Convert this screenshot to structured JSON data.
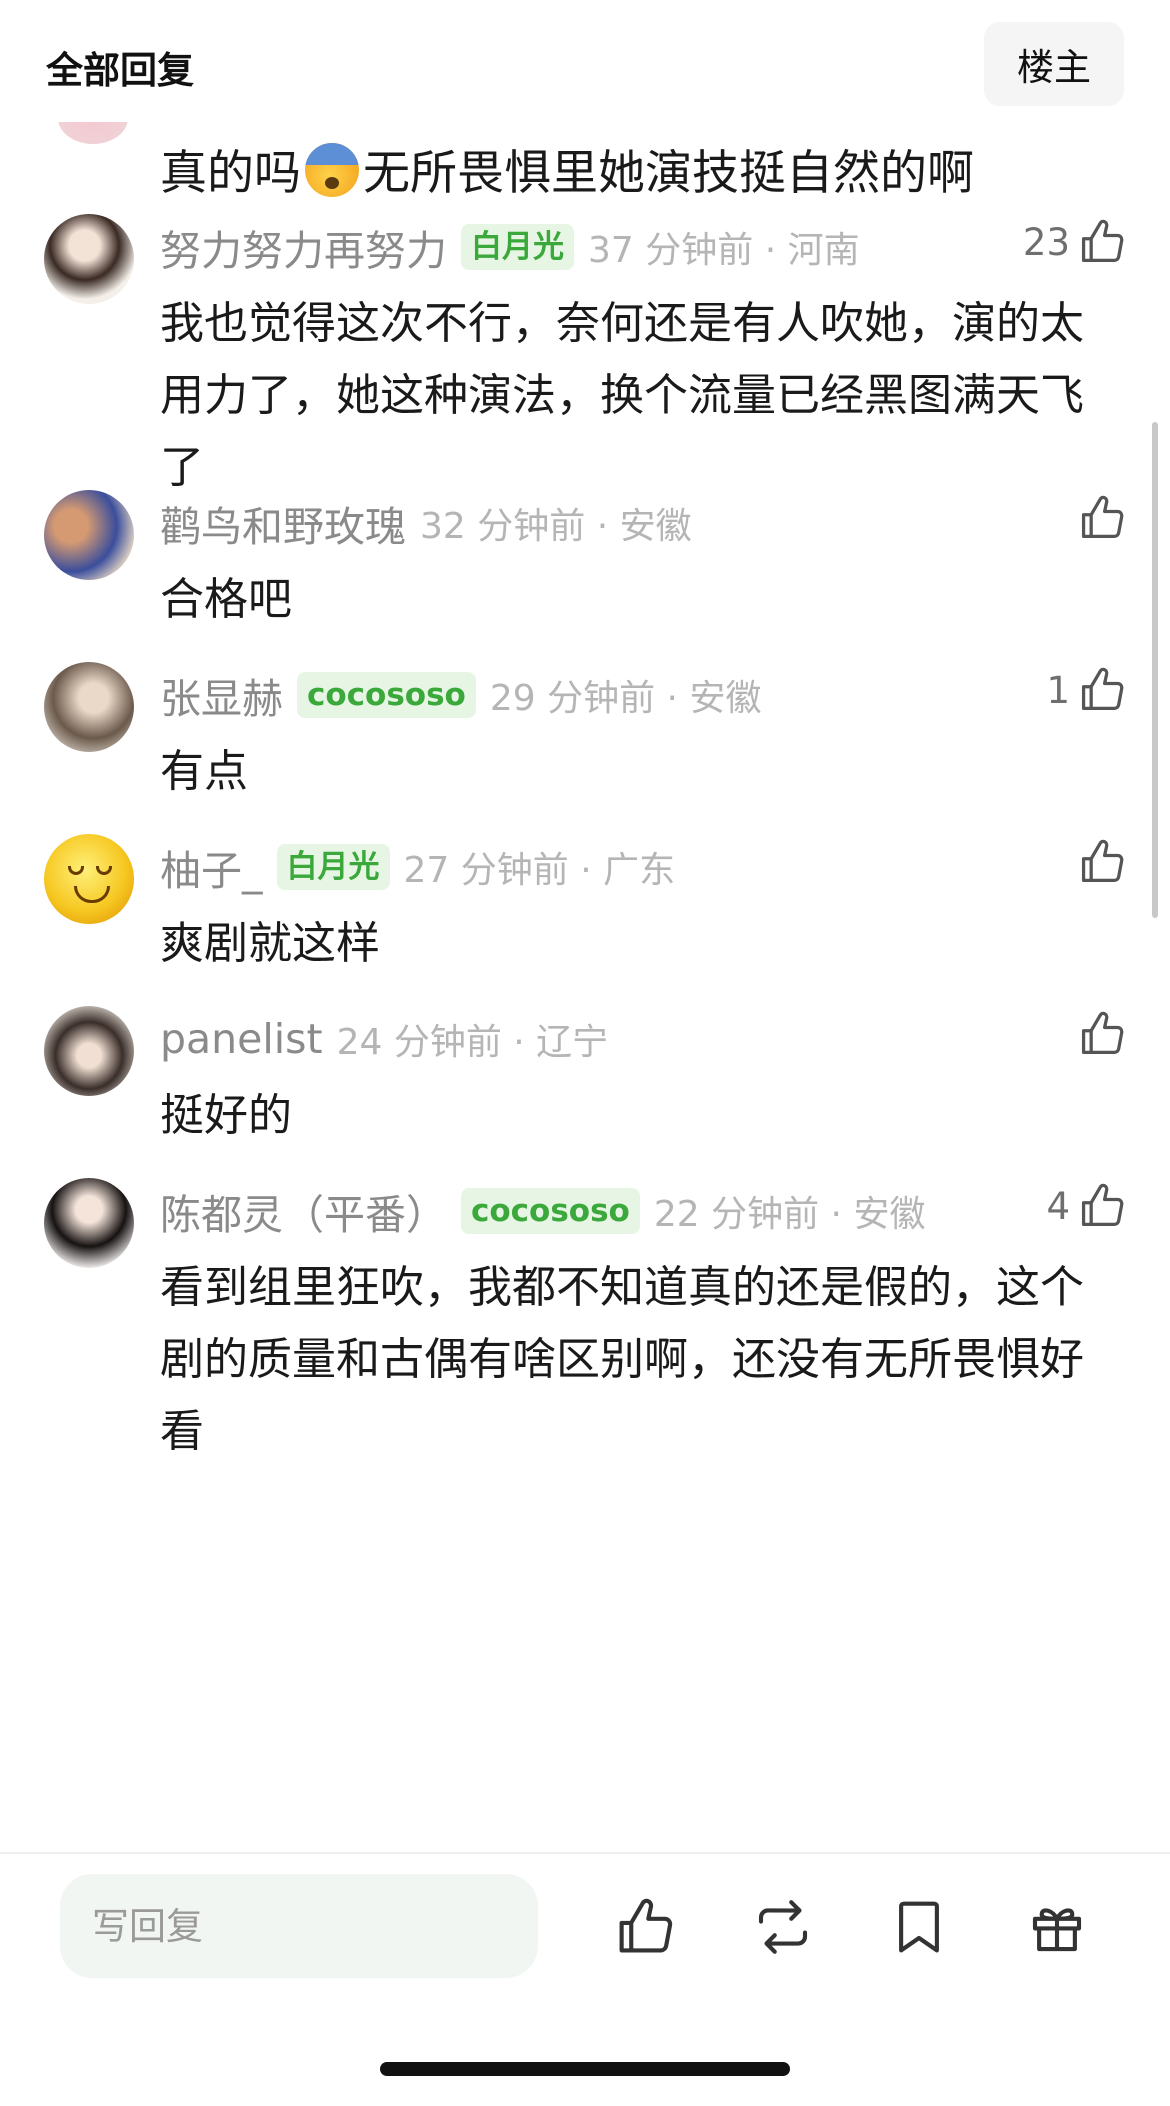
{
  "header": {
    "title": "全部回复",
    "op_button": "楼主"
  },
  "partial_comment": {
    "text_before": "真的吗",
    "emoji": "fearful-face-emoji",
    "text_after": "无所畏惧里她演技挺自然的啊"
  },
  "comments": [
    {
      "name": "努力努力再努力",
      "badge": "白月光",
      "time_loc": "37 分钟前 · 河南",
      "likes": "23",
      "text": "我也觉得这次不行，奈何还是有人吹她，演的太用力了，她这种演法，换个流量已经黑图满天飞了"
    },
    {
      "name": "鹳鸟和野玫瑰",
      "badge": "",
      "time_loc": "32 分钟前 · 安徽",
      "likes": "",
      "text": "合格吧"
    },
    {
      "name": "张显赫",
      "badge": "cocososo",
      "time_loc": "29 分钟前 · 安徽",
      "likes": "1",
      "text": "有点"
    },
    {
      "name": "柚子_",
      "badge": "白月光",
      "time_loc": "27 分钟前 · 广东",
      "likes": "",
      "text": "爽剧就这样"
    },
    {
      "name": "panelist",
      "badge": "",
      "time_loc": "24 分钟前 · 辽宁",
      "likes": "",
      "text": "挺好的"
    },
    {
      "name": "陈都灵（平番）",
      "badge": "cocososo",
      "time_loc": "22 分钟前 · 安徽",
      "likes": "4",
      "text": "看到组里狂吹，我都不知道真的还是假的，这个剧的质量和古偶有啥区别啊，还没有无所畏惧好看"
    }
  ],
  "footer": {
    "reply_placeholder": "写回复"
  },
  "colors": {
    "badge_bg": "#e7f6e4",
    "badge_text": "#3aa83a",
    "meta_gray": "#b5b5b5",
    "name_gray": "#8a8a8a"
  }
}
